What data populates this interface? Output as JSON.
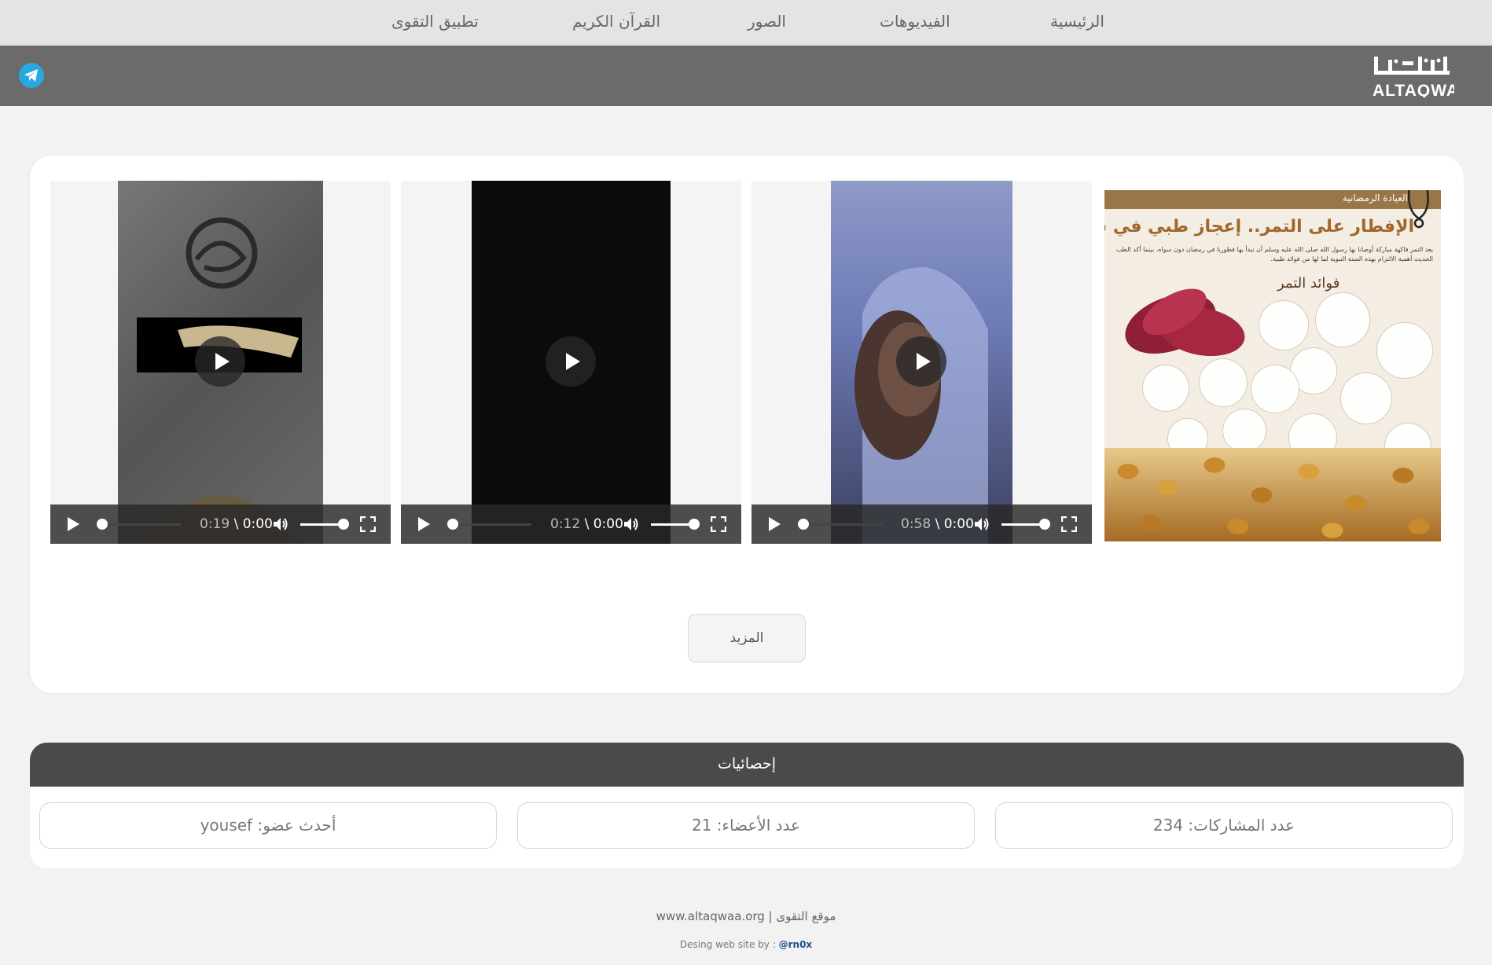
{
  "nav": {
    "items": [
      {
        "label": "الرئيسية"
      },
      {
        "label": "الفيديوهات"
      },
      {
        "label": "الصور"
      },
      {
        "label": "القرآن الكريم"
      },
      {
        "label": "تطبيق التقوى"
      }
    ]
  },
  "header": {
    "logo_text": "التقوى ALTAQWA",
    "telegram_icon": "telegram-icon"
  },
  "videos": [
    {
      "current": "0:00",
      "duration": "0:19"
    },
    {
      "current": "0:00",
      "duration": "0:12"
    },
    {
      "current": "0:00",
      "duration": "0:58"
    }
  ],
  "infographic": {
    "band": "العيادة الرمضانية",
    "title": "الإفطار على التمر.. إعجاز طبي في سنة نبوية",
    "subtitle": "يعد التمر فاكهة مباركة أوصانا بها رسول الله صلى الله عليه وسلم أن نبدأ بها فطورنا في رمضان دون سواه، بينما أكد الطب الحديث أهمية الالتزام بهذه السنة النبوية لما لها من فوائد طبية.",
    "benefits_heading": "فوائد التمر"
  },
  "more_button": "المزيد",
  "stats": {
    "title": "إحصائيات",
    "posts": "عدد المشاركات: 234",
    "members": "عدد الأعضاء: 21",
    "newest": "أحدث عضو: yousef"
  },
  "footer": {
    "line": "www.altaqwaa.org | موقع التقوى",
    "credit_prefix": "Desing web site by :",
    "credit_handle": "@rn0x"
  },
  "colors": {
    "nav_bg": "#e4e4e4",
    "header_bg": "#6b6b6b",
    "stats_head_bg": "#4a4a4a",
    "telegram": "#29a7e0",
    "credit_link": "#1f4e8c"
  }
}
